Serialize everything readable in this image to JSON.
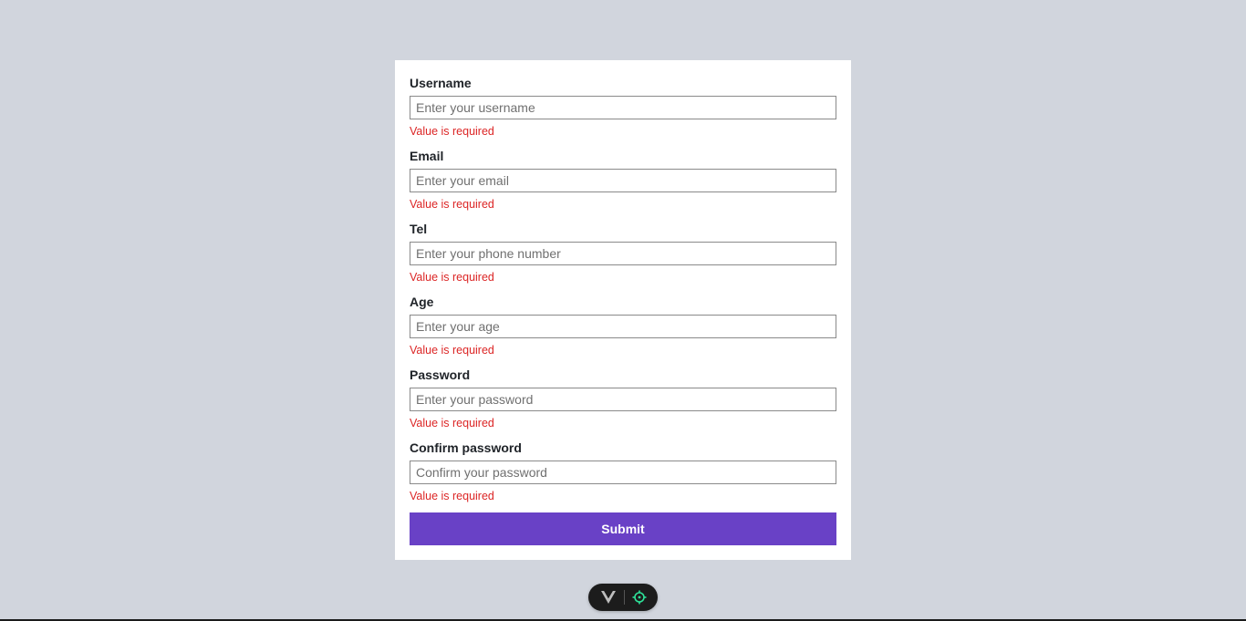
{
  "form": {
    "fields": [
      {
        "label": "Username",
        "placeholder": "Enter your username",
        "error": "Value is required"
      },
      {
        "label": "Email",
        "placeholder": "Enter your email",
        "error": "Value is required"
      },
      {
        "label": "Tel",
        "placeholder": "Enter your phone number",
        "error": "Value is required"
      },
      {
        "label": "Age",
        "placeholder": "Enter your age",
        "error": "Value is required"
      },
      {
        "label": "Password",
        "placeholder": "Enter your password",
        "error": "Value is required"
      },
      {
        "label": "Confirm password",
        "placeholder": "Confirm your password",
        "error": "Value is required"
      }
    ],
    "submit_label": "Submit"
  },
  "devtools": {
    "icons": [
      "vue-logo-icon",
      "crosshair-icon"
    ]
  },
  "colors": {
    "background": "#d1d5dd",
    "accent": "#6941c6",
    "error": "#dc2626",
    "devtools_green": "#2ee39a"
  }
}
